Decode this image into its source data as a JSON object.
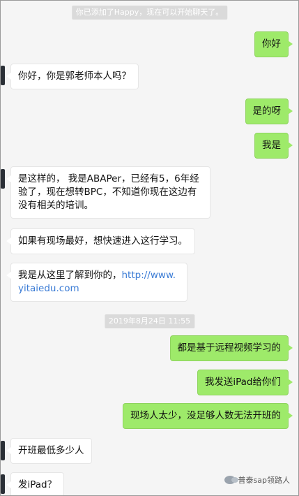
{
  "system_notices": {
    "added_friend": "你已添加了Happy，现在可以开始聊天了。",
    "timestamp": "2019年8月24日 11:55"
  },
  "messages": [
    {
      "side": "out",
      "text": "你好"
    },
    {
      "side": "in",
      "text": "你好，你是郭老师本人吗？"
    },
    {
      "side": "out",
      "text": "是的呀"
    },
    {
      "side": "out",
      "text": "我是"
    },
    {
      "side": "in",
      "line1": "是这样的， 我是ABAPer，已经有5，6年经",
      "line2": "验了，现在想转BPC，不知道你现在这边有",
      "line3": "没有相关的培训。"
    },
    {
      "side": "in",
      "text": "如果有现场最好，想快速进入这行学习。"
    },
    {
      "side": "in",
      "prefix": "我是从这里了解到你的，",
      "link1": "http://www.",
      "link2": "yitaiedu.com"
    },
    {
      "side": "out",
      "text": "都是基于远程视频学习的"
    },
    {
      "side": "out",
      "text": "我发送iPad给你们"
    },
    {
      "side": "out",
      "text": "现场人太少，没足够人数无法开班的"
    },
    {
      "side": "in",
      "text": "开班最低多少人"
    },
    {
      "side": "in",
      "text": "发iPad？"
    }
  ],
  "watermark": {
    "text": "普泰sap领路人"
  }
}
